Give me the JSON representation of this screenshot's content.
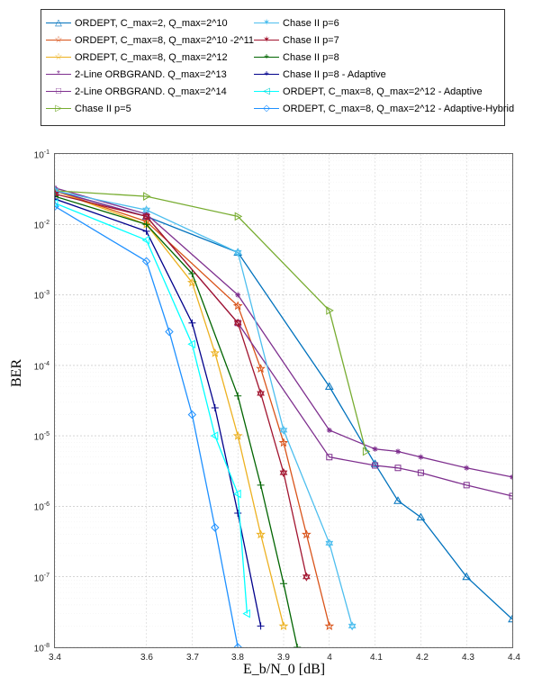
{
  "chart_data": {
    "type": "line",
    "xlabel": "E_b/N_0 [dB]",
    "ylabel": "BER",
    "xlim": [
      3.4,
      4.4
    ],
    "ylim": [
      1e-08,
      0.1
    ],
    "xticks": [
      3.4,
      3.6,
      3.7,
      3.8,
      3.9,
      4.0,
      4.1,
      4.2,
      4.3,
      4.4
    ],
    "yticks": [
      0.1,
      0.01,
      0.001,
      0.0001,
      1e-05,
      1e-06,
      1e-07,
      1e-08
    ],
    "yscale": "log",
    "series": [
      {
        "name": "ORDEPT, C_max=2, Q_max=2^10",
        "color": "#0072BD",
        "marker": "triangle",
        "x": [
          3.4,
          3.6,
          3.8,
          4.0,
          4.1,
          4.15,
          4.2,
          4.3,
          4.4
        ],
        "y": [
          0.03,
          0.013,
          0.004,
          5e-05,
          4e-06,
          1.2e-06,
          7e-07,
          1e-07,
          2.5e-08
        ]
      },
      {
        "name": "ORDEPT, C_max=8, Q_max=2^10 -2^11",
        "color": "#D95319",
        "marker": "pentagram",
        "x": [
          3.4,
          3.6,
          3.8,
          3.85,
          3.9,
          3.95,
          4.0
        ],
        "y": [
          0.03,
          0.011,
          0.0007,
          9e-05,
          8e-06,
          4e-07,
          2e-08
        ]
      },
      {
        "name": "ORDEPT, C_max=8, Q_max=2^12",
        "color": "#EDB120",
        "marker": "pentagram",
        "x": [
          3.4,
          3.6,
          3.7,
          3.75,
          3.8,
          3.85,
          3.9
        ],
        "y": [
          0.03,
          0.01,
          0.0015,
          0.00015,
          1e-05,
          4e-07,
          2e-08
        ]
      },
      {
        "name": "2-Line ORBGRAND. Q_max=2^13",
        "color": "#7E2F8E",
        "marker": "asterisk",
        "x": [
          3.4,
          3.6,
          3.8,
          4.0,
          4.1,
          4.15,
          4.2,
          4.3,
          4.4
        ],
        "y": [
          0.033,
          0.014,
          0.001,
          1.2e-05,
          6.5e-06,
          6e-06,
          5e-06,
          3.5e-06,
          2.6e-06
        ]
      },
      {
        "name": "2-Line ORBGRAND. Q_max=2^14",
        "color": "#7E2F8E",
        "marker": "square",
        "x": [
          3.4,
          3.6,
          3.8,
          4.0,
          4.1,
          4.15,
          4.2,
          4.3,
          4.4
        ],
        "y": [
          0.03,
          0.013,
          0.0004,
          5e-06,
          3.8e-06,
          3.5e-06,
          3e-06,
          2e-06,
          1.4e-06
        ]
      },
      {
        "name": "Chase II p=5",
        "color": "#77AC30",
        "marker": "triangle-right",
        "x": [
          3.4,
          3.6,
          3.8,
          4.0,
          4.08
        ],
        "y": [
          0.03,
          0.025,
          0.013,
          0.0006,
          6e-06
        ]
      },
      {
        "name": "Chase II p=6",
        "color": "#4DBEEE",
        "marker": "hexagram",
        "x": [
          3.4,
          3.6,
          3.8,
          3.9,
          4.0,
          4.05
        ],
        "y": [
          0.03,
          0.016,
          0.004,
          1.2e-05,
          3e-07,
          2e-08
        ]
      },
      {
        "name": "Chase II p=7",
        "color": "#A2142F",
        "marker": "hexagram",
        "x": [
          3.4,
          3.6,
          3.8,
          3.85,
          3.9,
          3.95
        ],
        "y": [
          0.027,
          0.013,
          0.0004,
          4e-05,
          3e-06,
          1e-07
        ]
      },
      {
        "name": "Chase II p=8",
        "color": "#006400",
        "marker": "plus",
        "x": [
          3.4,
          3.6,
          3.7,
          3.8,
          3.85,
          3.9,
          3.93
        ],
        "y": [
          0.025,
          0.01,
          0.002,
          3.7e-05,
          2e-06,
          8e-08,
          1e-08
        ]
      },
      {
        "name": "Chase II p=8 - Adaptive",
        "color": "#00008B",
        "marker": "plus",
        "x": [
          3.4,
          3.6,
          3.7,
          3.75,
          3.8,
          3.85
        ],
        "y": [
          0.023,
          0.008,
          0.0004,
          2.5e-05,
          8e-07,
          2e-08
        ]
      },
      {
        "name": "ORDEPT, C_max=8, Q_max=2^12 - Adaptive",
        "color": "#00FFFF",
        "marker": "triangle-left",
        "x": [
          3.4,
          3.6,
          3.7,
          3.75,
          3.8,
          3.82
        ],
        "y": [
          0.02,
          0.006,
          0.0002,
          1e-05,
          1.5e-06,
          3e-08
        ]
      },
      {
        "name": "ORDEPT, C_max=8, Q_max=2^12 - Adaptive-Hybrid",
        "color": "#1E90FF",
        "marker": "diamond",
        "x": [
          3.4,
          3.6,
          3.65,
          3.7,
          3.75,
          3.8
        ],
        "y": [
          0.018,
          0.003,
          0.0003,
          2e-05,
          5e-07,
          1e-08
        ]
      }
    ]
  }
}
